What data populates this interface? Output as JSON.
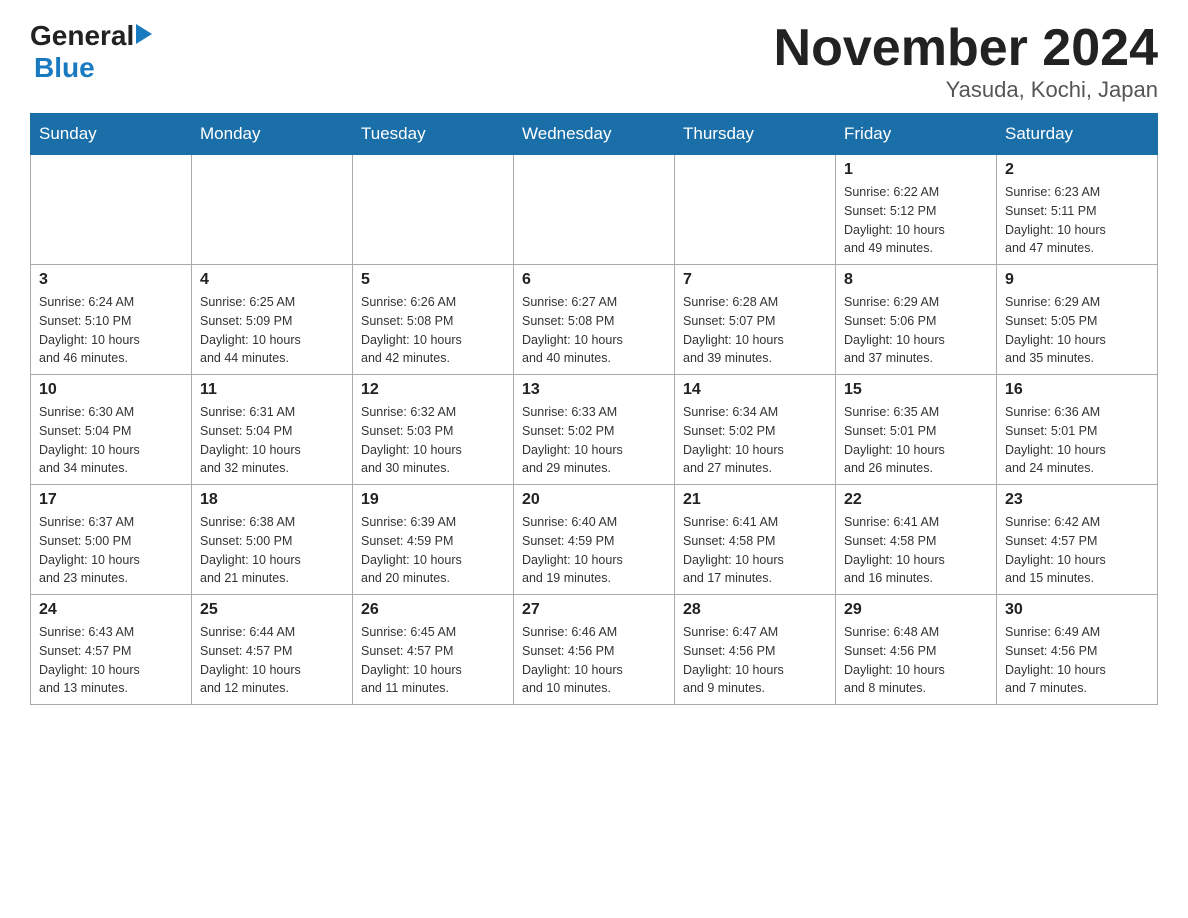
{
  "logo": {
    "general": "General",
    "blue": "Blue"
  },
  "title": "November 2024",
  "subtitle": "Yasuda, Kochi, Japan",
  "weekdays": [
    "Sunday",
    "Monday",
    "Tuesday",
    "Wednesday",
    "Thursday",
    "Friday",
    "Saturday"
  ],
  "weeks": [
    [
      {
        "day": "",
        "info": ""
      },
      {
        "day": "",
        "info": ""
      },
      {
        "day": "",
        "info": ""
      },
      {
        "day": "",
        "info": ""
      },
      {
        "day": "",
        "info": ""
      },
      {
        "day": "1",
        "info": "Sunrise: 6:22 AM\nSunset: 5:12 PM\nDaylight: 10 hours\nand 49 minutes."
      },
      {
        "day": "2",
        "info": "Sunrise: 6:23 AM\nSunset: 5:11 PM\nDaylight: 10 hours\nand 47 minutes."
      }
    ],
    [
      {
        "day": "3",
        "info": "Sunrise: 6:24 AM\nSunset: 5:10 PM\nDaylight: 10 hours\nand 46 minutes."
      },
      {
        "day": "4",
        "info": "Sunrise: 6:25 AM\nSunset: 5:09 PM\nDaylight: 10 hours\nand 44 minutes."
      },
      {
        "day": "5",
        "info": "Sunrise: 6:26 AM\nSunset: 5:08 PM\nDaylight: 10 hours\nand 42 minutes."
      },
      {
        "day": "6",
        "info": "Sunrise: 6:27 AM\nSunset: 5:08 PM\nDaylight: 10 hours\nand 40 minutes."
      },
      {
        "day": "7",
        "info": "Sunrise: 6:28 AM\nSunset: 5:07 PM\nDaylight: 10 hours\nand 39 minutes."
      },
      {
        "day": "8",
        "info": "Sunrise: 6:29 AM\nSunset: 5:06 PM\nDaylight: 10 hours\nand 37 minutes."
      },
      {
        "day": "9",
        "info": "Sunrise: 6:29 AM\nSunset: 5:05 PM\nDaylight: 10 hours\nand 35 minutes."
      }
    ],
    [
      {
        "day": "10",
        "info": "Sunrise: 6:30 AM\nSunset: 5:04 PM\nDaylight: 10 hours\nand 34 minutes."
      },
      {
        "day": "11",
        "info": "Sunrise: 6:31 AM\nSunset: 5:04 PM\nDaylight: 10 hours\nand 32 minutes."
      },
      {
        "day": "12",
        "info": "Sunrise: 6:32 AM\nSunset: 5:03 PM\nDaylight: 10 hours\nand 30 minutes."
      },
      {
        "day": "13",
        "info": "Sunrise: 6:33 AM\nSunset: 5:02 PM\nDaylight: 10 hours\nand 29 minutes."
      },
      {
        "day": "14",
        "info": "Sunrise: 6:34 AM\nSunset: 5:02 PM\nDaylight: 10 hours\nand 27 minutes."
      },
      {
        "day": "15",
        "info": "Sunrise: 6:35 AM\nSunset: 5:01 PM\nDaylight: 10 hours\nand 26 minutes."
      },
      {
        "day": "16",
        "info": "Sunrise: 6:36 AM\nSunset: 5:01 PM\nDaylight: 10 hours\nand 24 minutes."
      }
    ],
    [
      {
        "day": "17",
        "info": "Sunrise: 6:37 AM\nSunset: 5:00 PM\nDaylight: 10 hours\nand 23 minutes."
      },
      {
        "day": "18",
        "info": "Sunrise: 6:38 AM\nSunset: 5:00 PM\nDaylight: 10 hours\nand 21 minutes."
      },
      {
        "day": "19",
        "info": "Sunrise: 6:39 AM\nSunset: 4:59 PM\nDaylight: 10 hours\nand 20 minutes."
      },
      {
        "day": "20",
        "info": "Sunrise: 6:40 AM\nSunset: 4:59 PM\nDaylight: 10 hours\nand 19 minutes."
      },
      {
        "day": "21",
        "info": "Sunrise: 6:41 AM\nSunset: 4:58 PM\nDaylight: 10 hours\nand 17 minutes."
      },
      {
        "day": "22",
        "info": "Sunrise: 6:41 AM\nSunset: 4:58 PM\nDaylight: 10 hours\nand 16 minutes."
      },
      {
        "day": "23",
        "info": "Sunrise: 6:42 AM\nSunset: 4:57 PM\nDaylight: 10 hours\nand 15 minutes."
      }
    ],
    [
      {
        "day": "24",
        "info": "Sunrise: 6:43 AM\nSunset: 4:57 PM\nDaylight: 10 hours\nand 13 minutes."
      },
      {
        "day": "25",
        "info": "Sunrise: 6:44 AM\nSunset: 4:57 PM\nDaylight: 10 hours\nand 12 minutes."
      },
      {
        "day": "26",
        "info": "Sunrise: 6:45 AM\nSunset: 4:57 PM\nDaylight: 10 hours\nand 11 minutes."
      },
      {
        "day": "27",
        "info": "Sunrise: 6:46 AM\nSunset: 4:56 PM\nDaylight: 10 hours\nand 10 minutes."
      },
      {
        "day": "28",
        "info": "Sunrise: 6:47 AM\nSunset: 4:56 PM\nDaylight: 10 hours\nand 9 minutes."
      },
      {
        "day": "29",
        "info": "Sunrise: 6:48 AM\nSunset: 4:56 PM\nDaylight: 10 hours\nand 8 minutes."
      },
      {
        "day": "30",
        "info": "Sunrise: 6:49 AM\nSunset: 4:56 PM\nDaylight: 10 hours\nand 7 minutes."
      }
    ]
  ]
}
